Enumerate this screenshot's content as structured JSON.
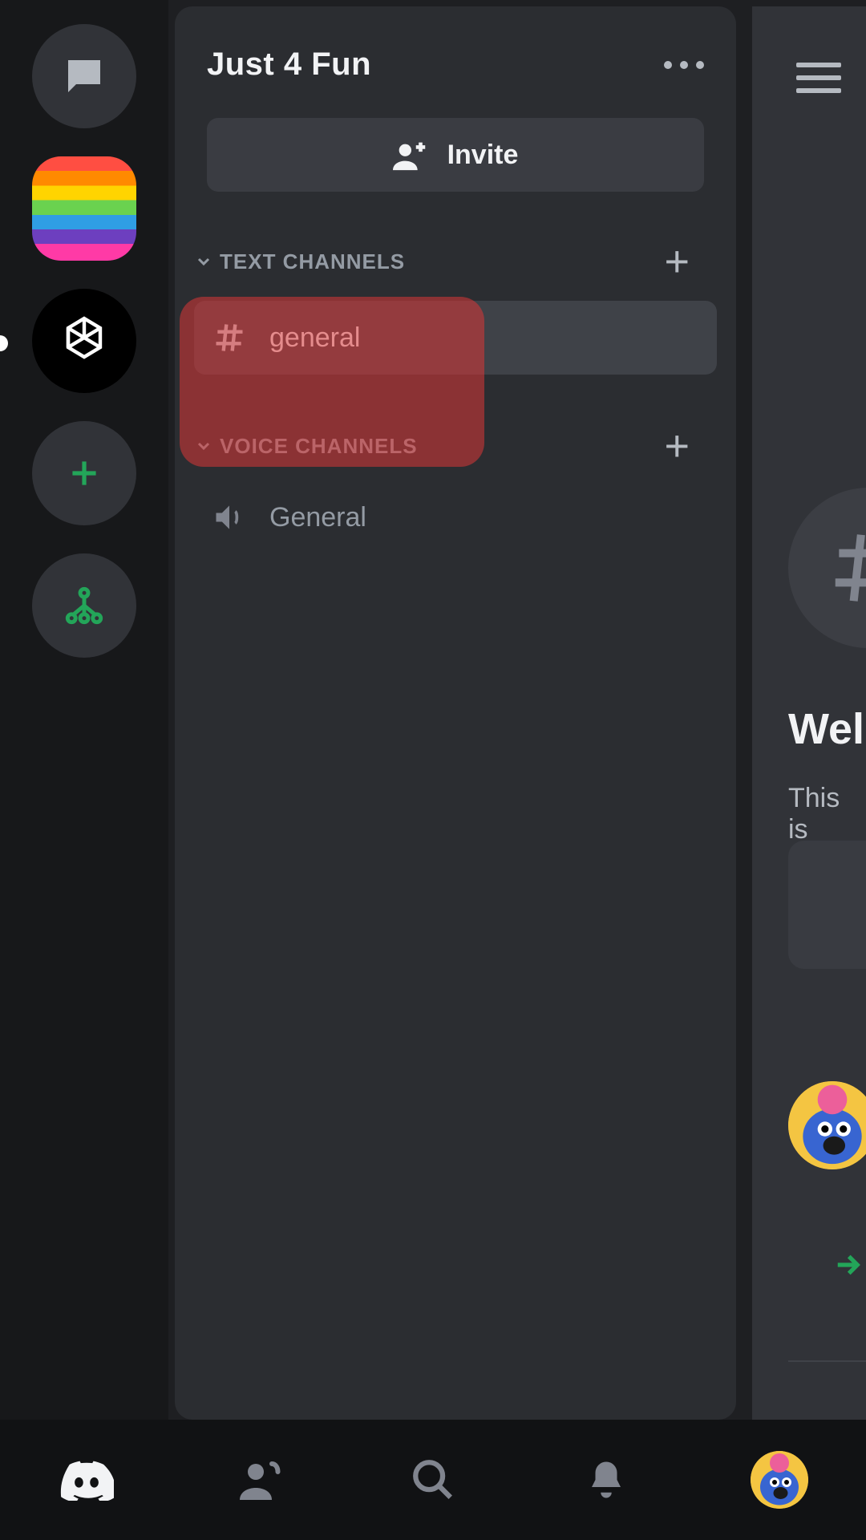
{
  "server": {
    "title": "Just 4 Fun",
    "invite_label": "Invite"
  },
  "sections": {
    "text": {
      "label": "TEXT CHANNELS"
    },
    "voice": {
      "label": "VOICE CHANNELS"
    }
  },
  "channels": {
    "text": [
      {
        "name": "general",
        "active": true
      }
    ],
    "voice": [
      {
        "name": "General"
      }
    ]
  },
  "main_peek": {
    "welcome": "Wel",
    "subtitle": "This is"
  },
  "rail_icons": {
    "dm": "chat-bubble-icon",
    "server_rainbow": "rainbow-server-icon",
    "server_openai": "openai-server-icon",
    "add": "add-server-icon",
    "explore": "explore-servers-icon"
  },
  "tabs": {
    "home": "discord-logo-icon",
    "friends": "friend-wave-icon",
    "search": "search-icon",
    "notifications": "bell-icon",
    "profile": "avatar-icon"
  },
  "colors": {
    "accent_green": "#23a559",
    "highlight_red": "rgba(219,55,55,0.55)"
  }
}
